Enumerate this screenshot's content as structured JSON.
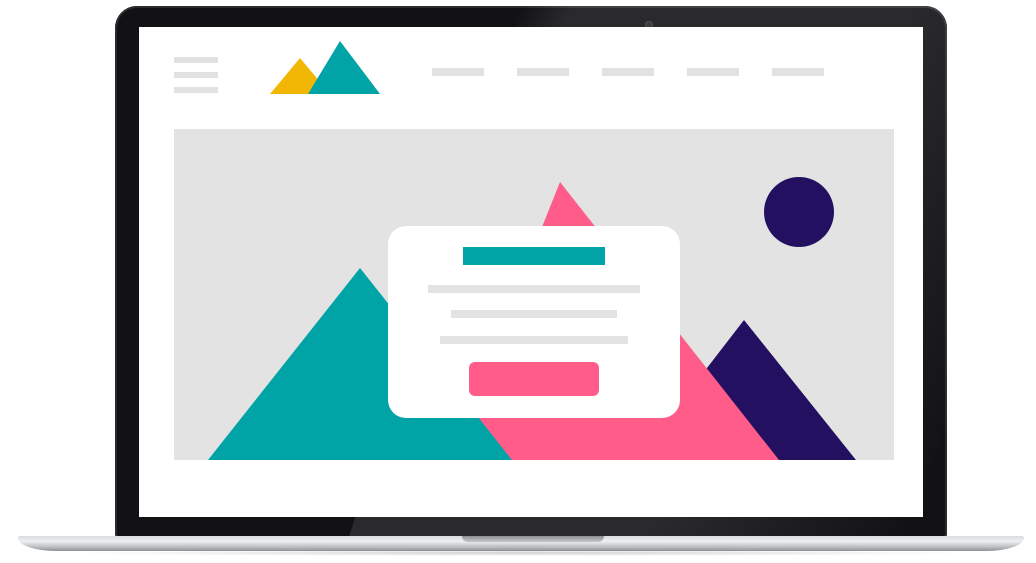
{
  "device": {
    "type": "laptop-mockup"
  },
  "colors": {
    "teal": "#00a4a6",
    "yellow": "#f2b705",
    "pink": "#ff5c8a",
    "navy": "#241060",
    "placeholder_gray": "#e2e2e2",
    "hero_background": "#e3e3e3",
    "bezel": "#121214"
  },
  "header": {
    "menu_icon": "hamburger-menu-icon",
    "logo_icon": "mountain-logo-icon",
    "nav_links": [
      "",
      "",
      "",
      "",
      ""
    ]
  },
  "hero": {
    "illustration": [
      "mountain-left-teal",
      "mountain-center-pink",
      "mountain-right-navy",
      "sun-circle-navy"
    ],
    "card": {
      "title": "",
      "lines": [
        "",
        "",
        ""
      ],
      "button_label": ""
    }
  }
}
